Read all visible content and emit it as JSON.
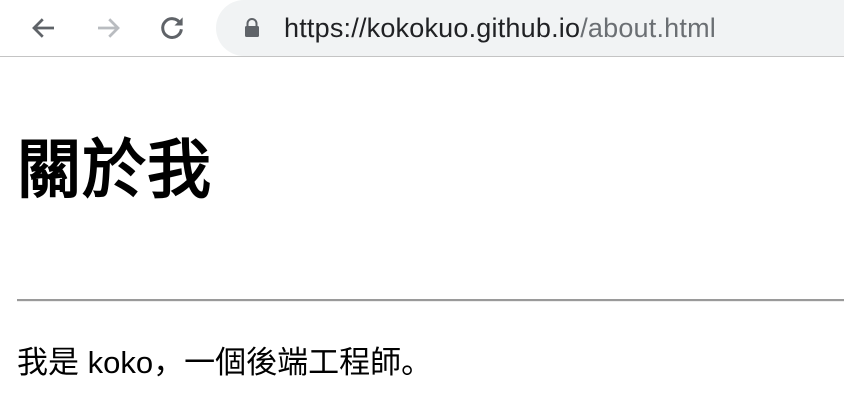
{
  "browser": {
    "back_icon": "arrow-left-icon",
    "forward_icon": "arrow-right-icon",
    "reload_icon": "reload-icon",
    "lock_icon": "lock-icon",
    "url_host": "https://kokokuo.github.io",
    "url_path": "/about.html"
  },
  "page": {
    "heading": "關於我",
    "intro": "我是 koko，一個後端工程師。"
  }
}
